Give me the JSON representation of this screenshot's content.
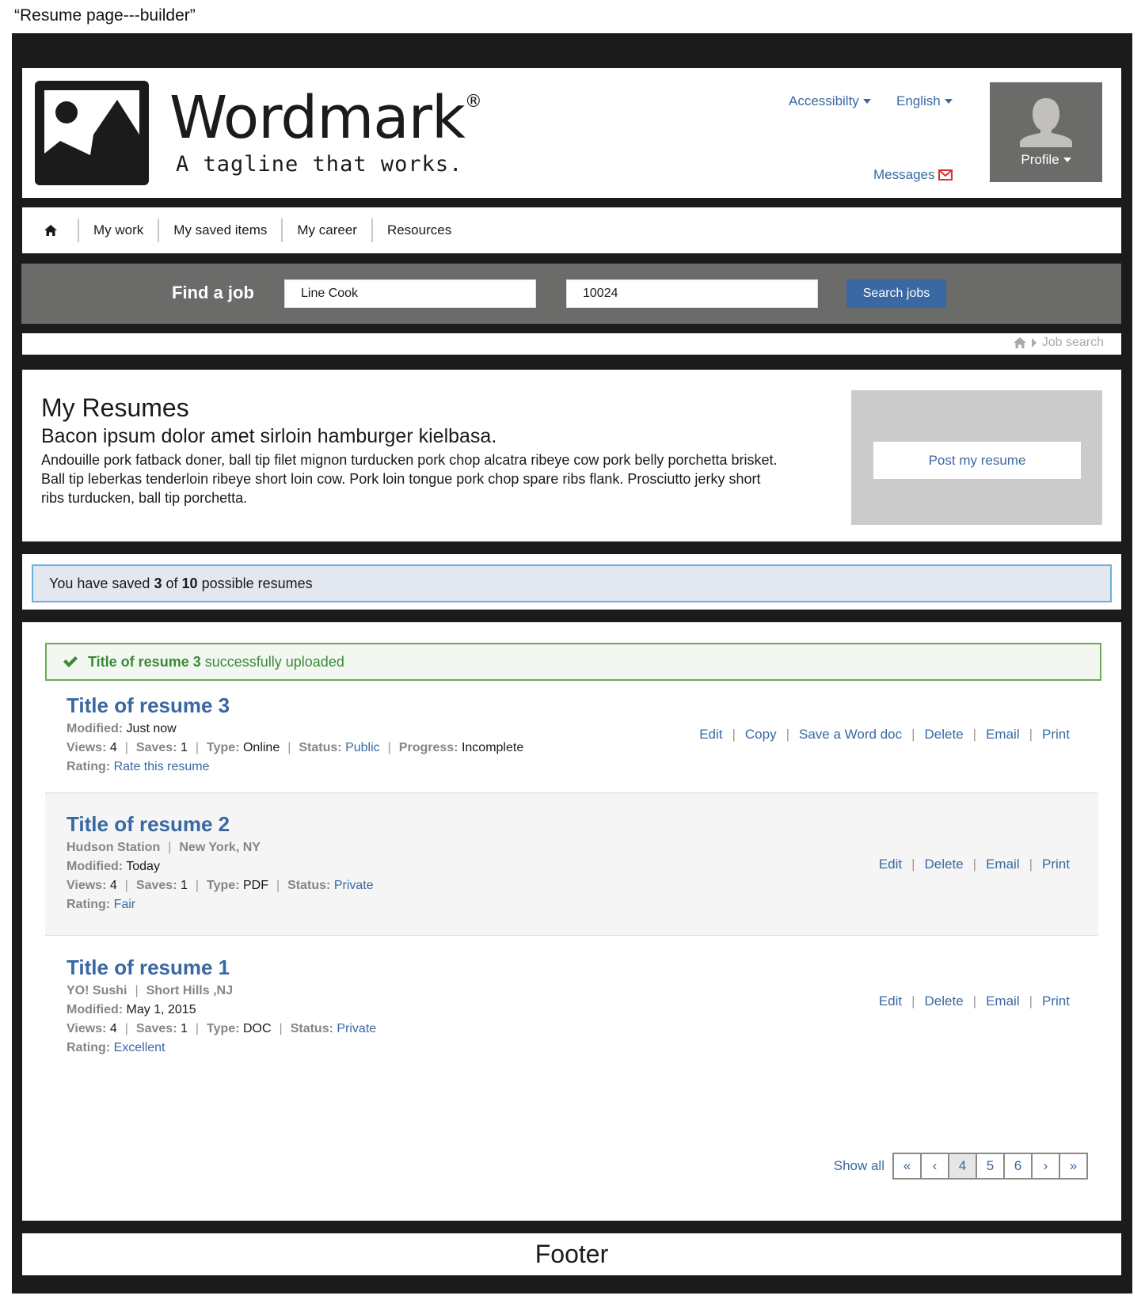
{
  "caption": "“Resume page---builder”",
  "header": {
    "wordmark": "Wordmark",
    "registered": "®",
    "tagline": "A tagline that works.",
    "accessibility_label": "Accessibilty",
    "language_label": "English",
    "messages_label": "Messages",
    "profile_label": "Profile"
  },
  "nav": {
    "items": [
      {
        "label": "My work"
      },
      {
        "label": "My saved items"
      },
      {
        "label": "My career"
      },
      {
        "label": "Resources"
      }
    ]
  },
  "search": {
    "title": "Find a job",
    "job_value": "Line Cook",
    "zip_value": "10024",
    "button_label": "Search jobs"
  },
  "breadcrumb": {
    "current": "Job search"
  },
  "intro": {
    "title": "My Resumes",
    "subtitle": "Bacon ipsum dolor amet sirloin hamburger kielbasa.",
    "body": "Andouille pork fatback doner, ball tip filet mignon turducken pork chop alcatra ribeye cow pork belly porchetta brisket. Ball tip leberkas tenderloin ribeye short loin cow. Pork loin tongue pork chop spare ribs flank. Prosciutto jerky short ribs turducken, ball tip porchetta.",
    "post_button": "Post my resume"
  },
  "saved": {
    "prefix": "You have saved",
    "count": "3",
    "of": "of",
    "max": "10",
    "suffix": "possible resumes"
  },
  "success": {
    "title": "Title of resume 3",
    "message": "successfully uploaded"
  },
  "labels": {
    "modified": "Modified:",
    "views": "Views:",
    "saves": "Saves:",
    "type": "Type:",
    "status": "Status:",
    "progress": "Progress:",
    "rating": "Rating:",
    "sep": "|"
  },
  "resumes": [
    {
      "title": "Title of resume 3",
      "modified": "Just now",
      "views": "4",
      "saves": "1",
      "type": "Online",
      "status": "Public",
      "progress": "Incomplete",
      "rating": "Rate this resume",
      "actions": [
        "Edit",
        "Copy",
        "Save a Word doc",
        "Delete",
        "Email",
        "Print"
      ]
    },
    {
      "title": "Title of resume 2",
      "employer": "Hudson Station",
      "location": "New York, NY",
      "modified": "Today",
      "views": "4",
      "saves": "1",
      "type": "PDF",
      "status": "Private",
      "rating": "Fair",
      "actions": [
        "Edit",
        "Delete",
        "Email",
        "Print"
      ]
    },
    {
      "title": "Title of resume 1",
      "employer": "YO! Sushi",
      "location": "Short Hills ,NJ",
      "modified": "May 1, 2015",
      "views": "4",
      "saves": "1",
      "type": "DOC",
      "status": "Private",
      "rating": "Excellent",
      "actions": [
        "Edit",
        "Delete",
        "Email",
        "Print"
      ]
    }
  ],
  "pagination": {
    "show_all": "Show all",
    "first": "«",
    "prev": "‹",
    "pages": [
      "4",
      "5",
      "6"
    ],
    "current": "4",
    "next": "›",
    "last": "»"
  },
  "footer": {
    "label": "Footer"
  },
  "colors": {
    "accent": "#3a68a3",
    "success": "#3b8a35",
    "info_border": "#6aafd9",
    "frame": "#1b1b1b",
    "band": "#6b6b69",
    "alert_icon": "#d9302a"
  }
}
